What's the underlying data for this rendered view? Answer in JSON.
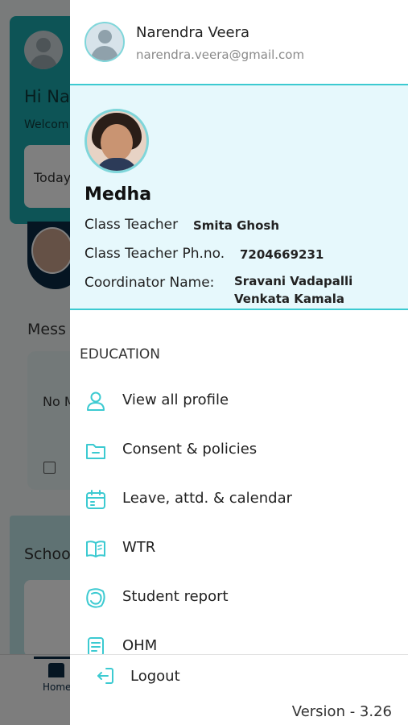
{
  "background": {
    "greeting": "Hi Na",
    "welcome": "Welcom",
    "today": "Today",
    "messages_heading": "Mess",
    "no_messages": "No M",
    "school_heading": "Schoo",
    "nav_home": "Home"
  },
  "user": {
    "name": "Narendra Veera",
    "email": "narendra.veera@gmail.com",
    "avatar_icon": "user-avatar-icon"
  },
  "student": {
    "name": "Medha",
    "class_teacher_label": "Class Teacher",
    "class_teacher_value": "Smita Ghosh",
    "teacher_phone_label": "Class Teacher Ph.no.",
    "teacher_phone_value": "7204669231",
    "coordinator_label": "Coordinator Name:",
    "coordinator_value_line1": "Sravani Vadapalli",
    "coordinator_value_line2": "Venkata Kamala"
  },
  "menu": {
    "section": "EDUCATION",
    "items": [
      {
        "label": "View all profile",
        "icon": "profile-icon"
      },
      {
        "label": "Consent & policies",
        "icon": "folder-icon"
      },
      {
        "label": "Leave, attd. & calendar",
        "icon": "calendar-icon"
      },
      {
        "label": "WTR",
        "icon": "book-icon"
      },
      {
        "label": "Student report",
        "icon": "report-icon"
      },
      {
        "label": "OHM",
        "icon": "notebook-icon"
      }
    ]
  },
  "footer": {
    "logout": "Logout",
    "version": "Version - 3.26"
  },
  "colors": {
    "accent": "#3ccad1",
    "card_bg": "#e6f8fc",
    "app_teal": "#1aa9ac"
  }
}
